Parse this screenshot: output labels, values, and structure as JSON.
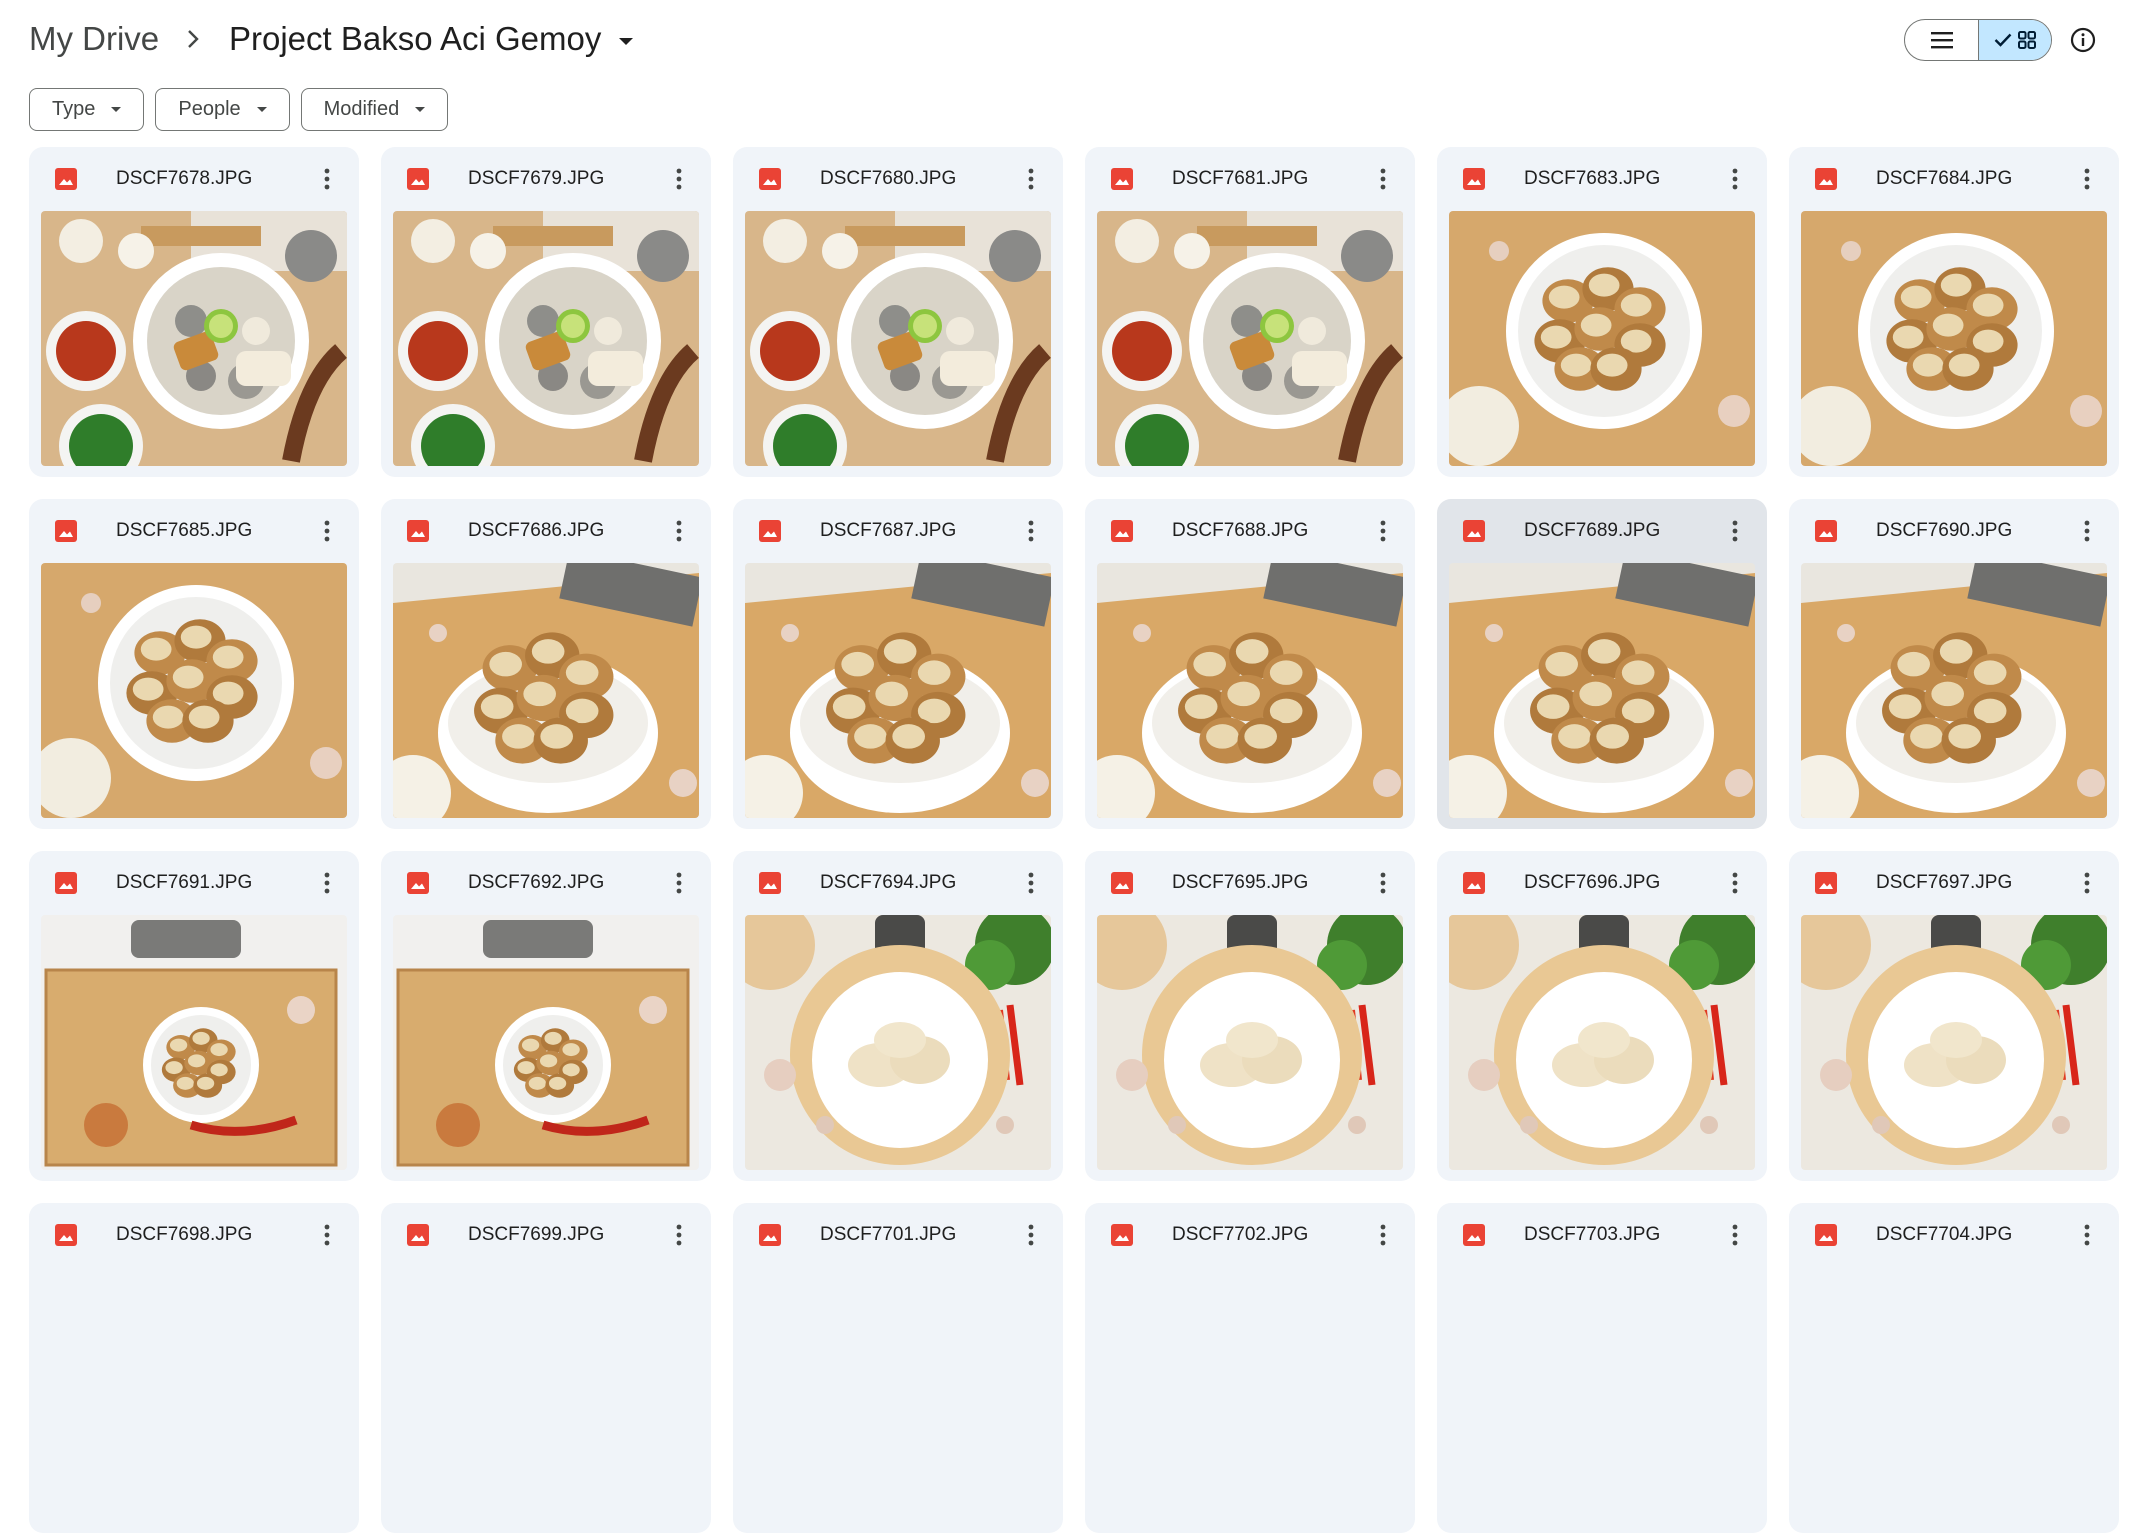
{
  "breadcrumb": {
    "root": "My Drive",
    "current": "Project Bakso Aci Gemoy"
  },
  "filters": [
    "Type",
    "People",
    "Modified"
  ],
  "view": {
    "selected": "grid"
  },
  "icons": {
    "separator": "chevron-right-icon",
    "list_view": "list-icon",
    "grid_view": "grid-icon",
    "selected": "check-icon",
    "info": "info-icon",
    "file": "image-file-icon",
    "more": "more-vert-icon"
  },
  "colors": {
    "file_icon": "#ea4335",
    "card_bg": "#f0f4f9",
    "selected_toggle": "#c2e7ff"
  },
  "files": [
    {
      "name": "DSCF7678.JPG",
      "scene": "soup"
    },
    {
      "name": "DSCF7679.JPG",
      "scene": "soup"
    },
    {
      "name": "DSCF7680.JPG",
      "scene": "soup"
    },
    {
      "name": "DSCF7681.JPG",
      "scene": "soup"
    },
    {
      "name": "DSCF7683.JPG",
      "scene": "fried-top"
    },
    {
      "name": "DSCF7684.JPG",
      "scene": "fried-top"
    },
    {
      "name": "DSCF7685.JPG",
      "scene": "fried-top"
    },
    {
      "name": "DSCF7686.JPG",
      "scene": "fried-angle"
    },
    {
      "name": "DSCF7687.JPG",
      "scene": "fried-angle"
    },
    {
      "name": "DSCF7688.JPG",
      "scene": "fried-angle"
    },
    {
      "name": "DSCF7689.JPG",
      "scene": "fried-angle",
      "hover": true
    },
    {
      "name": "DSCF7690.JPG",
      "scene": "fried-angle"
    },
    {
      "name": "DSCF7691.JPG",
      "scene": "tray"
    },
    {
      "name": "DSCF7692.JPG",
      "scene": "tray"
    },
    {
      "name": "DSCF7694.JPG",
      "scene": "plate"
    },
    {
      "name": "DSCF7695.JPG",
      "scene": "plate"
    },
    {
      "name": "DSCF7696.JPG",
      "scene": "plate"
    },
    {
      "name": "DSCF7697.JPG",
      "scene": "plate"
    },
    {
      "name": "DSCF7698.JPG",
      "scene": "none"
    },
    {
      "name": "DSCF7699.JPG",
      "scene": "none"
    },
    {
      "name": "DSCF7701.JPG",
      "scene": "none"
    },
    {
      "name": "DSCF7702.JPG",
      "scene": "none"
    },
    {
      "name": "DSCF7703.JPG",
      "scene": "none"
    },
    {
      "name": "DSCF7704.JPG",
      "scene": "none"
    }
  ]
}
